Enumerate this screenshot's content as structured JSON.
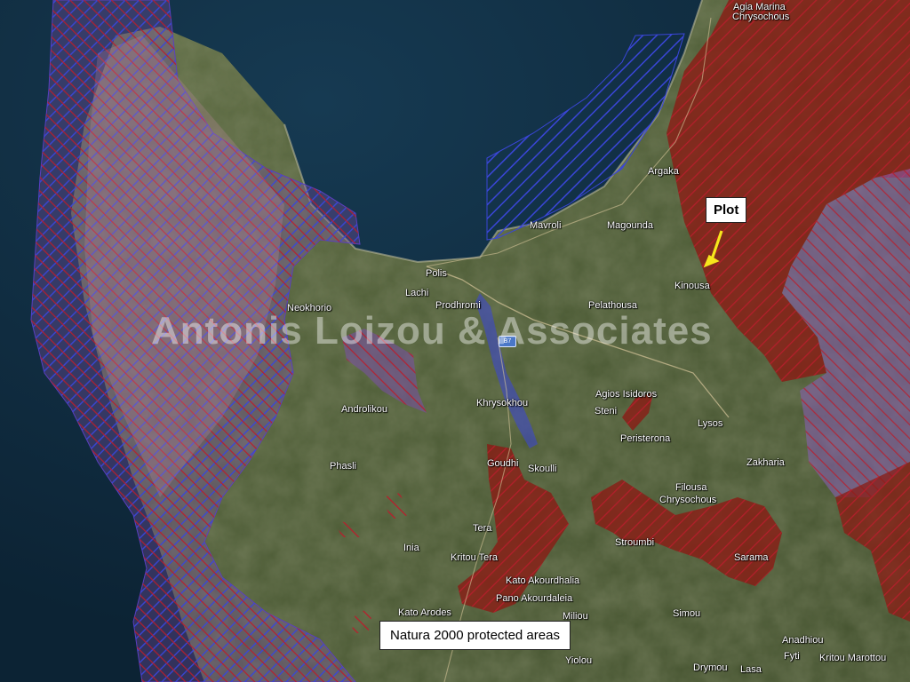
{
  "map": {
    "watermark": "Antonis Loizou & Associates",
    "plot_label": "Plot",
    "legend_label": "Natura 2000 protected areas",
    "road_label": "B7",
    "colors": {
      "sea_deep": "#0f2b3e",
      "sea_shallow": "#163a52",
      "land": "#5a6a3e",
      "land_dark": "#3e4a2c",
      "hatch_blue": "#3a46d8",
      "hatch_red": "#b81e2c",
      "forest_red": "#8a1c14",
      "arrow": "#f6e61c"
    },
    "places": [
      {
        "id": "agia-marina",
        "label": "Agia Marina"
      },
      {
        "id": "chrysochous-north",
        "label": "Chrysochous"
      },
      {
        "id": "argaka",
        "label": "Argaka"
      },
      {
        "id": "mavroli",
        "label": "Mavroli"
      },
      {
        "id": "magounda",
        "label": "Magounda"
      },
      {
        "id": "polis",
        "label": "Polis"
      },
      {
        "id": "lachi",
        "label": "Lachi"
      },
      {
        "id": "prodhromi",
        "label": "Prodhromi"
      },
      {
        "id": "kinousa",
        "label": "Kinousa"
      },
      {
        "id": "neokhorio",
        "label": "Neokhorio"
      },
      {
        "id": "pelathousa",
        "label": "Pelathousa"
      },
      {
        "id": "agios-isidoros",
        "label": "Agios Isidoros"
      },
      {
        "id": "steni",
        "label": "Steni"
      },
      {
        "id": "androlikou",
        "label": "Androlikou"
      },
      {
        "id": "khrysokhou",
        "label": "Khrysokhou"
      },
      {
        "id": "peristerona",
        "label": "Peristerona"
      },
      {
        "id": "lysos",
        "label": "Lysos"
      },
      {
        "id": "zakharia",
        "label": "Zakharia"
      },
      {
        "id": "phasli",
        "label": "Phasli"
      },
      {
        "id": "goudhi",
        "label": "Goudhi"
      },
      {
        "id": "skoulli",
        "label": "Skoulli"
      },
      {
        "id": "filousa",
        "label": "Filousa"
      },
      {
        "id": "chrysochous-south",
        "label": "Chrysochous"
      },
      {
        "id": "tera",
        "label": "Tera"
      },
      {
        "id": "inia",
        "label": "Inia"
      },
      {
        "id": "kritou-tera",
        "label": "Kritou Tera"
      },
      {
        "id": "stroumbi",
        "label": "Stroumbi"
      },
      {
        "id": "sarama",
        "label": "Sarama"
      },
      {
        "id": "kato-akourdhalia",
        "label": "Kato Akourdhalia"
      },
      {
        "id": "pano-akourdaleia",
        "label": "Pano Akourdaleia"
      },
      {
        "id": "kato-arodes",
        "label": "Kato Arodes"
      },
      {
        "id": "miliou",
        "label": "Miliou"
      },
      {
        "id": "simou",
        "label": "Simou"
      },
      {
        "id": "yiolou",
        "label": "Yiolou"
      },
      {
        "id": "drymou",
        "label": "Drymou"
      },
      {
        "id": "lasa",
        "label": "Lasa"
      },
      {
        "id": "anadhiou",
        "label": "Anadhiou"
      },
      {
        "id": "fyti",
        "label": "Fyti"
      },
      {
        "id": "kritou-marottou",
        "label": "Kritou Marottou"
      }
    ]
  }
}
